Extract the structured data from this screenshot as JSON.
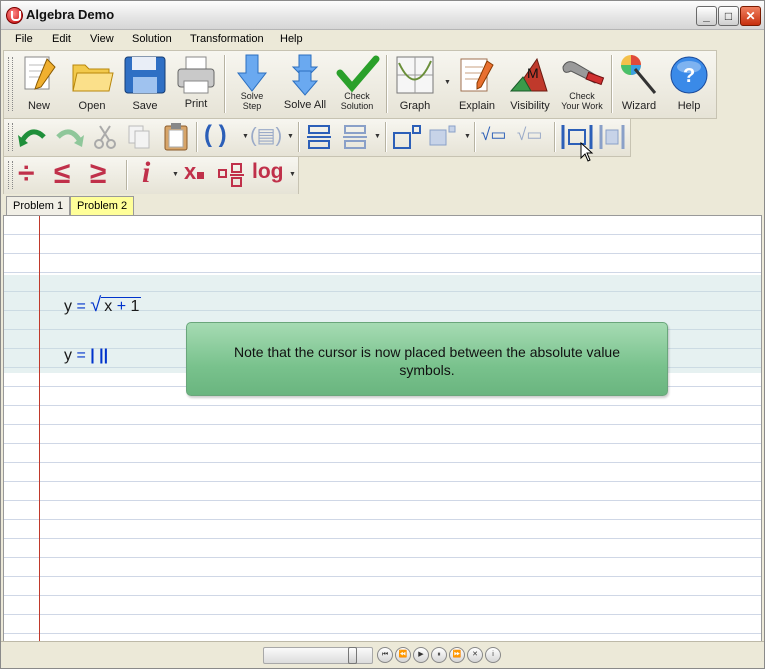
{
  "window": {
    "title": "Algebra Demo",
    "minimize": "_",
    "maximize": "□",
    "close": "✕"
  },
  "menu": [
    "File",
    "Edit",
    "View",
    "Solution",
    "Transformation",
    "Help"
  ],
  "toolbar_main": {
    "new": "New",
    "open": "Open",
    "save": "Save",
    "print": "Print",
    "solve_step": [
      "Solve",
      "Step"
    ],
    "solve_all": "Solve All",
    "check_solution": [
      "Check",
      "Solution"
    ],
    "graph": "Graph",
    "explain": "Explain",
    "visibility": "Visibility",
    "check_work": [
      "Check",
      "Your Work"
    ],
    "wizard": "Wizard",
    "help": "Help",
    "visibility_letter": "M",
    "help_glyph": "?"
  },
  "toolbar_edit": {
    "parens": "( )",
    "bracket_glyph": "(▤)",
    "sqrt1": "√▭",
    "sqrt2": "√▭"
  },
  "toolbar_math": {
    "divide": "÷",
    "less_equal": "≤",
    "greater_equal": "≥",
    "info": "i",
    "subscript": "x",
    "log": "log"
  },
  "tabs": [
    {
      "label": "Problem 1",
      "active": false
    },
    {
      "label": "Problem 2",
      "active": true
    }
  ],
  "equations": {
    "eq1": {
      "lhs": "y",
      "eq": "=",
      "radicand_var": "x",
      "plus": "+",
      "const": "1"
    },
    "eq2": {
      "lhs": "y",
      "eq": "=",
      "abs": "| ||"
    }
  },
  "note": "Note that the cursor is now placed between the absolute value symbols.",
  "playback": {
    "first": "⏮",
    "rewind": "⏪",
    "play": "▶",
    "pause": "⏸",
    "forward": "⏩",
    "stop": "✕",
    "info": "i",
    "progress": 0.85
  }
}
